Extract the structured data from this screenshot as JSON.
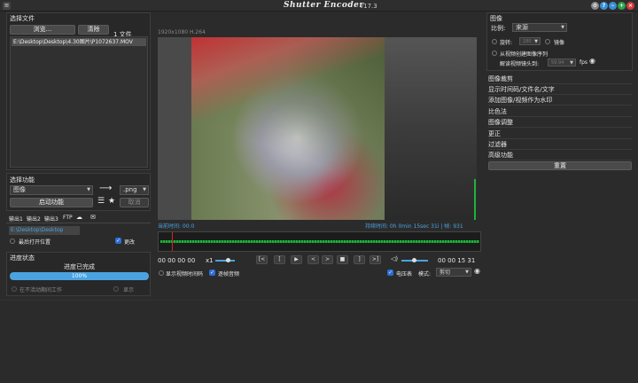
{
  "window": {
    "title": "Shutter Encoder",
    "version": "v17.3"
  },
  "file_section": {
    "heading": "选择文件",
    "browse_button": "浏览...",
    "clear_button": "清除",
    "file_count": "1 文件",
    "files": [
      "E:\\Desktop\\Desktop\\4.30图片\\P1072637.MOV"
    ]
  },
  "function_section": {
    "heading": "选择功能",
    "function_value": "图像",
    "format_value": ".png",
    "start_button": "启动功能",
    "cancel_button": "取消"
  },
  "output_section": {
    "tabs": [
      "输出1",
      "输出2",
      "输出3",
      "FTP"
    ],
    "path": "E:\\Desktop\\Desktop",
    "open_last_label": "最后打开位置",
    "change_label": "更改"
  },
  "progress_section": {
    "heading": "进度状态",
    "status": "进度已完成",
    "percent_text": "100%",
    "percent": 100,
    "inactive_label": "在不活动期间工作",
    "display_label": "显示"
  },
  "preview": {
    "info": "1920x1080 H.264",
    "current_time_label": "当前时间: 00:0",
    "duration_text": "持续时间:  0h 0min 15sec 31i | 帧:  931"
  },
  "playback": {
    "timecode_in": "00 00 00 00",
    "speed": "x1",
    "timecode_out": "00 00 15 31",
    "buttons": [
      "[<",
      "[",
      "▶",
      "<",
      ">",
      "■",
      "]",
      ">]"
    ],
    "show_timecode_label": "显示视频时间码",
    "frame_audio_label": "逐帧音频",
    "vu_label": "电压表",
    "mode_label": "模式:",
    "mode_value": "剪切"
  },
  "image_panel": {
    "heading": "图像",
    "ratio_label": "比例:",
    "ratio_value": "来源",
    "rotate_label": "旋转:",
    "rotate_value": "180",
    "mirror_label": "镜像",
    "sequence_label": "从视频创建图像序列",
    "read_header_label": "解读视频镜头到:",
    "fps_value": "59.94",
    "fps_unit": "fps"
  },
  "menu_items": [
    "图像裁剪",
    "显示时间码/文件名/文字",
    "添加图像/视频作为水印",
    "比色法",
    "图像调整",
    "更正",
    "过滤器",
    "高级功能"
  ],
  "reset_button": "重置",
  "colors": {
    "accent": "#4aa3e0",
    "waveform": "#1db33a",
    "playhead": "#e02020"
  }
}
